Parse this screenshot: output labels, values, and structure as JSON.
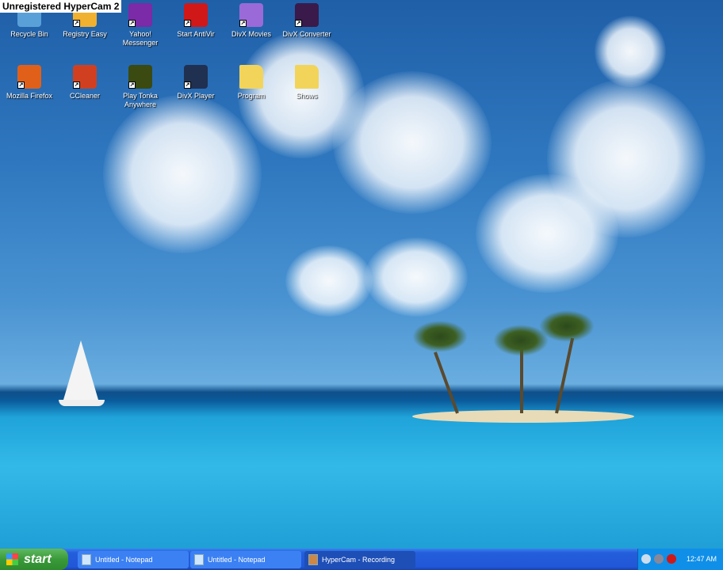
{
  "watermark": "Unregistered HyperCam 2",
  "desktop_icons": [
    {
      "label": "Recycle Bin",
      "icon": "recycle-bin-icon",
      "color": "#5aa0d8"
    },
    {
      "label": "Registry Easy",
      "icon": "registry-easy-icon",
      "color": "#f0b030"
    },
    {
      "label": "Yahoo! Messenger",
      "icon": "yahoo-messenger-icon",
      "color": "#7b2aa8"
    },
    {
      "label": "Start AntiVir",
      "icon": "antivir-icon",
      "color": "#d01818"
    },
    {
      "label": "DivX Movies",
      "icon": "divx-movies-icon",
      "color": "#9a6ad8"
    },
    {
      "label": "DivX Converter",
      "icon": "divx-converter-icon",
      "color": "#3a1a4a"
    },
    {
      "label": "Mozilla Firefox",
      "icon": "firefox-icon",
      "color": "#e0601a"
    },
    {
      "label": "CCleaner",
      "icon": "ccleaner-icon",
      "color": "#d04020"
    },
    {
      "label": "Play Tonka Anywhere",
      "icon": "game-icon",
      "color": "#3a4a10"
    },
    {
      "label": "DivX Player",
      "icon": "divx-player-icon",
      "color": "#203050"
    },
    {
      "label": "Program",
      "icon": "folder-icon",
      "color": "#f2d45a"
    },
    {
      "label": "Shows",
      "icon": "folder-icon",
      "color": "#f2d45a"
    }
  ],
  "taskbar": {
    "start_label": "start",
    "tasks": [
      {
        "label": "Untitled - Notepad",
        "active": false
      },
      {
        "label": "Untitled - Notepad",
        "active": false
      },
      {
        "label": "HyperCam - Recording",
        "active": true
      }
    ],
    "clock": "12:47 AM"
  }
}
